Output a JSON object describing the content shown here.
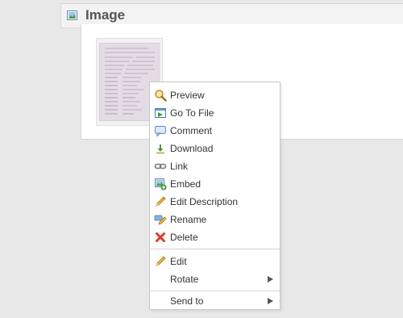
{
  "header": {
    "title": "Image",
    "icon": "image-icon"
  },
  "thumbnail": {
    "icon": "document-scan-thumbnail"
  },
  "context_menu": {
    "items": [
      {
        "label": "Preview",
        "icon": "magnifier-icon"
      },
      {
        "label": "Go To File",
        "icon": "go-to-file-icon"
      },
      {
        "label": "Comment",
        "icon": "comment-icon"
      },
      {
        "label": "Download",
        "icon": "download-icon"
      },
      {
        "label": "Link",
        "icon": "link-icon"
      },
      {
        "label": "Embed",
        "icon": "embed-icon"
      },
      {
        "label": "Edit Description",
        "icon": "pencil-icon"
      },
      {
        "label": "Rename",
        "icon": "rename-icon"
      },
      {
        "label": "Delete",
        "icon": "delete-icon"
      },
      {
        "label": "Edit",
        "icon": "pencil-icon"
      },
      {
        "label": "Rotate",
        "icon": "",
        "submenu": true
      },
      {
        "label": "Send to",
        "icon": "",
        "submenu": true
      }
    ]
  },
  "colors": {
    "background": "#e8e8e8",
    "menu_text": "#333333",
    "header_text": "#555555"
  }
}
